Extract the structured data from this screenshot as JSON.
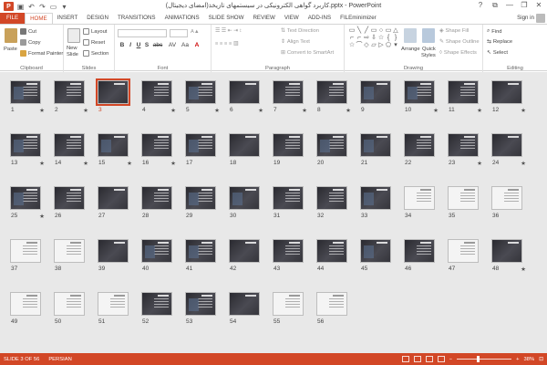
{
  "window": {
    "title": "کاربرد گواهی الکترونیکی در سیستمهای تازیخذ(امضای دیجیتال).pptx - PowerPoint",
    "app_badge": "P",
    "controls": [
      "?",
      "⧉",
      "—",
      "❐",
      "✕"
    ]
  },
  "tabs": [
    {
      "label": "FILE",
      "kind": "file"
    },
    {
      "label": "HOME",
      "kind": "active"
    },
    {
      "label": "INSERT"
    },
    {
      "label": "DESIGN"
    },
    {
      "label": "TRANSITIONS"
    },
    {
      "label": "ANIMATIONS"
    },
    {
      "label": "SLIDE SHOW"
    },
    {
      "label": "REVIEW"
    },
    {
      "label": "VIEW"
    },
    {
      "label": "ADD-INS"
    },
    {
      "label": "FILEminimizer"
    }
  ],
  "signin": "Sign in",
  "ribbon": {
    "clipboard": {
      "label": "Clipboard",
      "paste": "Paste",
      "cut": "Cut",
      "copy": "Copy",
      "format_painter": "Format Painter"
    },
    "slides": {
      "label": "Slides",
      "new_slide_1": "New",
      "new_slide_2": "Slide",
      "layout": "Layout",
      "reset": "Reset",
      "section": "Section"
    },
    "font": {
      "label": "Font",
      "bold": "B",
      "italic": "I",
      "underline": "U",
      "strike": "S",
      "shadow": "abc",
      "spacing": "AV",
      "case": "Aa",
      "color": "A"
    },
    "paragraph": {
      "label": "Paragraph",
      "text_direction": "Text Direction",
      "align_text": "Align Text",
      "convert_smartart": "Convert to SmartArt"
    },
    "drawing": {
      "label": "Drawing",
      "arrange": "Arrange",
      "quick_styles_1": "Quick",
      "quick_styles_2": "Styles",
      "shape_fill": "Shape Fill",
      "shape_outline": "Shape Outline",
      "shape_effects": "Shape Effects"
    },
    "editing": {
      "label": "Editing",
      "find": "Find",
      "replace": "Replace",
      "select": "Select"
    }
  },
  "slides": {
    "selected": 3,
    "starred": [
      1,
      2,
      4,
      5,
      6,
      7,
      8,
      10,
      11,
      12,
      13,
      14,
      15,
      16,
      23,
      24,
      25,
      48
    ],
    "light": [
      34,
      35,
      36,
      37,
      38,
      47,
      49,
      50,
      51,
      55,
      56
    ]
  },
  "status": {
    "slide_info": "SLIDE 3 OF 56",
    "language": "PERSIAN",
    "zoom_minus": "−",
    "zoom_plus": "+",
    "zoom": "38%",
    "zoom_value": 0.38
  },
  "colors": {
    "accent": "#d24726",
    "thumb_dark": "#3a3a40",
    "thumb_light": "#f4f4f4"
  }
}
